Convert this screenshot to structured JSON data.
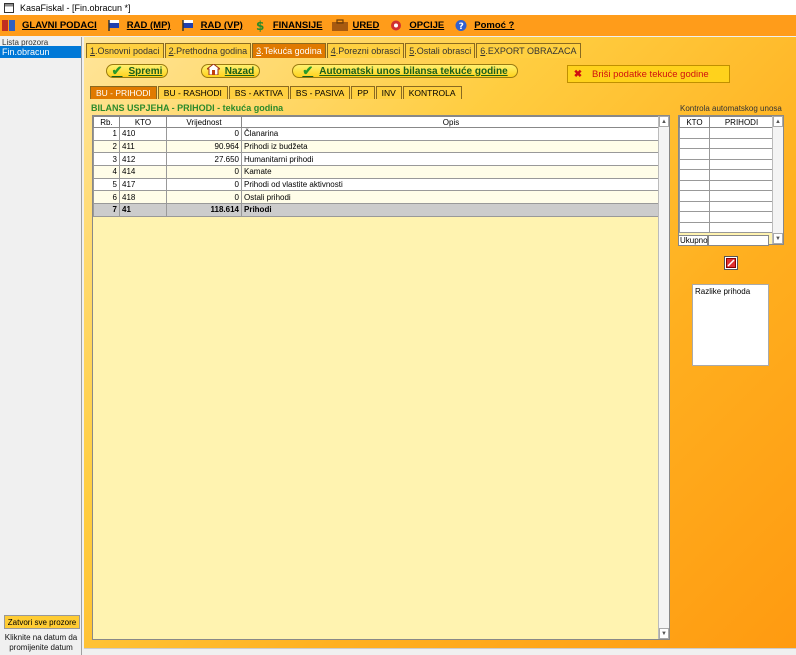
{
  "window": {
    "title": "KasaFiskal  - [Fin.obracun *]"
  },
  "menu": [
    {
      "label": "GLAVNI PODACI",
      "icon": "ledger-icon"
    },
    {
      "label": "RAD (MP)",
      "icon": "flag-icon"
    },
    {
      "label": "RAD (VP)",
      "icon": "flag-icon"
    },
    {
      "label": "FINANSIJE",
      "icon": "finance-icon"
    },
    {
      "label": "URED",
      "icon": "office-icon"
    },
    {
      "label": "OPCIJE",
      "icon": "options-icon"
    },
    {
      "label": "Pomoć ?",
      "icon": "help-icon"
    }
  ],
  "sidebar": {
    "title": "Lista prozora",
    "items": [
      "Fin.obracun"
    ],
    "close_all": "Zatvori sve prozore",
    "hint": "Kliknite na datum da promijenite datum"
  },
  "tabs_top": [
    {
      "num": "1",
      "label": ".Osnovni podaci",
      "active": false
    },
    {
      "num": "2",
      "label": ".Prethodna godina",
      "active": false
    },
    {
      "num": "3",
      "label": ".Tekuća godina",
      "active": true
    },
    {
      "num": "4",
      "label": ".Porezni obrasci",
      "active": false
    },
    {
      "num": "5",
      "label": ".Ostali obrasci",
      "active": false
    },
    {
      "num": "6",
      "label": ".EXPORT OBRAZACA",
      "active": false
    }
  ],
  "toolbar": {
    "save": "Spremi",
    "back": "Nazad",
    "auto": "Automatski unos bilansa tekuće godine",
    "delete": "Briši podatke tekuće godine"
  },
  "tabs_sub": [
    {
      "label": "BU - PRIHODI",
      "active": true
    },
    {
      "label": "BU - RASHODI",
      "active": false
    },
    {
      "label": "BS - AKTIVA",
      "active": false
    },
    {
      "label": "BS - PASIVA",
      "active": false
    },
    {
      "label": "PP",
      "active": false
    },
    {
      "label": "INV",
      "active": false
    },
    {
      "label": "KONTROLA",
      "active": false
    }
  ],
  "section": {
    "title": "BILANS USPJEHA - PRIHODI - tekuća godina"
  },
  "grid": {
    "columns": [
      "Rb.",
      "KTO",
      "Vrijednost",
      "Opis"
    ],
    "rows": [
      [
        "1",
        "410",
        "0",
        "Članarina"
      ],
      [
        "2",
        "411",
        "90.964",
        "Prihodi iz budžeta"
      ],
      [
        "3",
        "412",
        "27.650",
        "Humanitarni prihodi"
      ],
      [
        "4",
        "414",
        "0",
        "Kamate"
      ],
      [
        "5",
        "417",
        "0",
        "Prihodi od vlastite aktivnosti"
      ],
      [
        "6",
        "418",
        "0",
        "Ostali prihodi"
      ],
      [
        "7",
        "41",
        "118.614",
        "Prihodi"
      ]
    ]
  },
  "control": {
    "title": "Kontrola automatskog unosa",
    "columns": [
      "KTO",
      "PRIHODI"
    ],
    "total_label": "Ukupno",
    "diff_label": "Razlike prihoda"
  }
}
